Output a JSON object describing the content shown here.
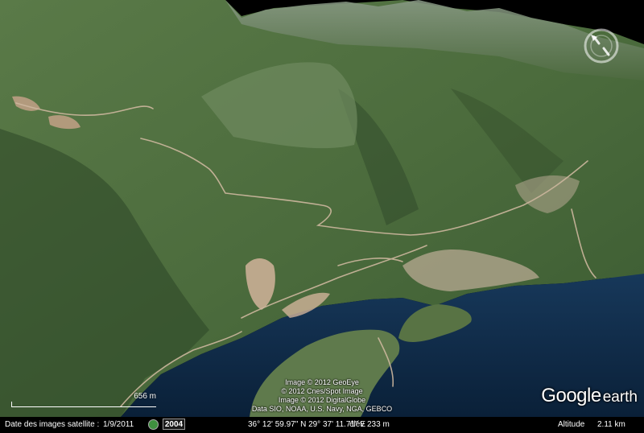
{
  "attribution": {
    "lines": [
      "Image © 2012 GeoEye",
      "© 2012 Cnes/Spot Image",
      "Image © 2012 DigitalGlobe",
      "Data SIO, NOAA, U.S. Navy, NGA, GEBCO"
    ]
  },
  "logo": {
    "brand": "Google",
    "product": "earth"
  },
  "scale_bar": {
    "label": "656 m"
  },
  "navigation": {
    "icon": "compass-rose-icon"
  },
  "status": {
    "imagery_date_label": "Date des images satellite :",
    "imagery_date": "1/9/2011",
    "historical_icon": "clock-globe-icon",
    "year": "2004",
    "coordinates": "36° 12' 59.97\" N  29° 37' 11.71\" E",
    "elevation_label": "élév",
    "elevation": "233 m",
    "altitude_label": "Altitude",
    "altitude": "2.11 km"
  },
  "colors": {
    "sea": "#0e2a47",
    "mountain": "#4f6f3f",
    "ridge_shadow": "#2c4527",
    "road": "#cdb79e",
    "sky": "#000000"
  }
}
